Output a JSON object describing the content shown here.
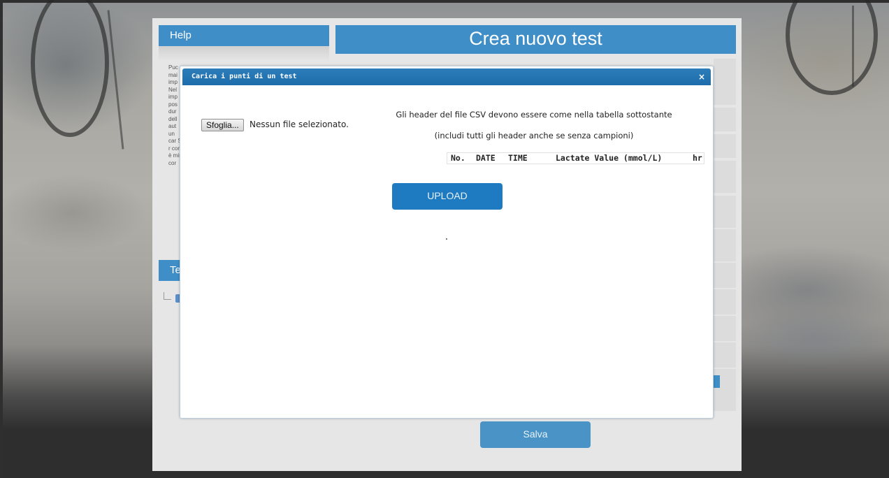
{
  "help": {
    "title": "Help",
    "text": "Puc mai imp Nel imp pos dur dell aut un car Si r cor è mis cor"
  },
  "tests_panel": {
    "title": "Te"
  },
  "main": {
    "title": "Crea nuovo test"
  },
  "save_label": "Salva",
  "modal": {
    "title": "Carica i punti di un test",
    "close": "×",
    "browse_label": "Sfoglia...",
    "no_file_text": "Nessun file selezionato.",
    "instructions_1": "Gli header del file CSV devono essere come nella tabella sottostante",
    "instructions_2": "(includi tutti gli header anche se senza campioni)",
    "csv_headers": [
      "No.",
      "DATE",
      "TIME",
      "Lactate Value (mmol/L)",
      "hr"
    ],
    "upload_label": "UPLOAD"
  },
  "colors": {
    "accent": "#3f8ec7",
    "modal_header": "#1e6cab",
    "upload_button": "#1f7bc1"
  }
}
